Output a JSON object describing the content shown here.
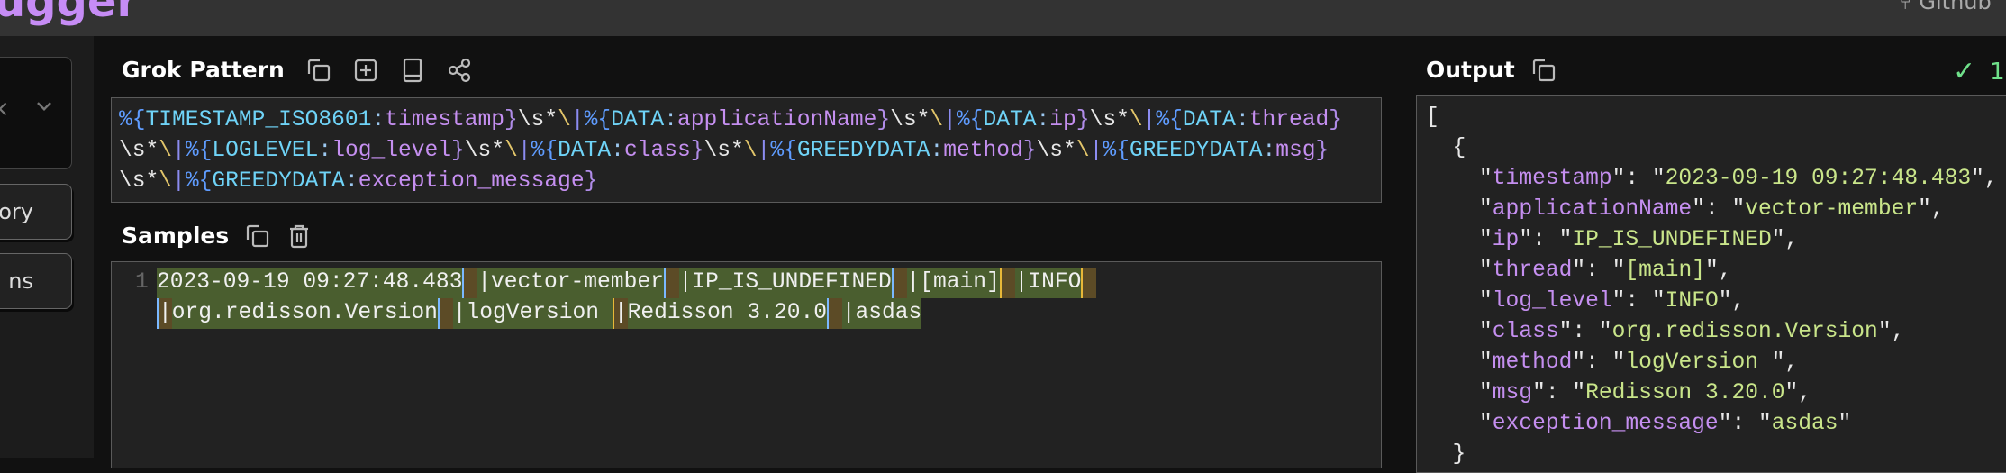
{
  "header": {
    "logo_text": "ugger",
    "github_label": "Github"
  },
  "sidebar": {
    "clear_glyph": "×",
    "buttons": [
      {
        "label": "tory"
      },
      {
        "label": "ns"
      }
    ]
  },
  "grok": {
    "title": "Grok Pattern",
    "icons": [
      "copy-icon",
      "add-icon",
      "book-icon",
      "share-icon"
    ],
    "lines": [
      [
        [
          "%{",
          "p-pct"
        ],
        [
          "TIMESTAMP_ISO8601",
          "p-name"
        ],
        [
          ":",
          "p-col"
        ],
        [
          "timestamp",
          "p-field"
        ],
        [
          "}",
          "p-cl"
        ],
        [
          "\\s*",
          "p-ws"
        ],
        [
          "\\",
          "p-bs"
        ],
        [
          "|",
          "p-bar"
        ],
        [
          "%{",
          "p-pct"
        ],
        [
          "DATA",
          "p-name"
        ],
        [
          ":",
          "p-col"
        ],
        [
          "applicationName",
          "p-field"
        ],
        [
          "}",
          "p-cl"
        ],
        [
          "\\s*",
          "p-ws"
        ],
        [
          "\\",
          "p-bs"
        ],
        [
          "|",
          "p-bar"
        ],
        [
          "%{",
          "p-pct"
        ],
        [
          "DATA",
          "p-name"
        ],
        [
          ":",
          "p-col"
        ],
        [
          "ip",
          "p-field"
        ],
        [
          "}",
          "p-cl"
        ],
        [
          "\\s*",
          "p-ws"
        ],
        [
          "\\",
          "p-bs"
        ],
        [
          "|",
          "p-bar"
        ],
        [
          "%{",
          "p-pct"
        ],
        [
          "DATA",
          "p-name"
        ],
        [
          ":",
          "p-col"
        ],
        [
          "thread",
          "p-field"
        ],
        [
          "}",
          "p-cl"
        ]
      ],
      [
        [
          "\\s*",
          "p-ws"
        ],
        [
          "\\",
          "p-bs"
        ],
        [
          "|",
          "p-bar"
        ],
        [
          "%{",
          "p-pct"
        ],
        [
          "LOGLEVEL",
          "p-name"
        ],
        [
          ":",
          "p-col"
        ],
        [
          "log_level",
          "p-field"
        ],
        [
          "}",
          "p-cl"
        ],
        [
          "\\s*",
          "p-ws"
        ],
        [
          "\\",
          "p-bs"
        ],
        [
          "|",
          "p-bar"
        ],
        [
          "%{",
          "p-pct"
        ],
        [
          "DATA",
          "p-name"
        ],
        [
          ":",
          "p-col"
        ],
        [
          "class",
          "p-field"
        ],
        [
          "}",
          "p-cl"
        ],
        [
          "\\s*",
          "p-ws"
        ],
        [
          "\\",
          "p-bs"
        ],
        [
          "|",
          "p-bar"
        ],
        [
          "%{",
          "p-pct"
        ],
        [
          "GREEDYDATA",
          "p-name"
        ],
        [
          ":",
          "p-col"
        ],
        [
          "method",
          "p-field"
        ],
        [
          "}",
          "p-cl"
        ],
        [
          "\\s*",
          "p-ws"
        ],
        [
          "\\",
          "p-bs"
        ],
        [
          "|",
          "p-bar"
        ],
        [
          "%{",
          "p-pct"
        ],
        [
          "GREEDYDATA",
          "p-name"
        ],
        [
          ":",
          "p-col"
        ],
        [
          "msg",
          "p-field"
        ],
        [
          "}",
          "p-cl"
        ]
      ],
      [
        [
          "\\s*",
          "p-ws"
        ],
        [
          "\\",
          "p-bs"
        ],
        [
          "|",
          "p-bar"
        ],
        [
          "%{",
          "p-pct"
        ],
        [
          "GREEDYDATA",
          "p-name"
        ],
        [
          ":",
          "p-col"
        ],
        [
          "exception_message",
          "p-field"
        ],
        [
          "}",
          "p-cl"
        ]
      ]
    ]
  },
  "samples": {
    "title": "Samples",
    "icons": [
      "copy-icon",
      "trash-icon"
    ],
    "line_number": "1",
    "lines": [
      [
        [
          "2023-09-19 09:27:48.483",
          "tok"
        ],
        [
          " ",
          "sep"
        ],
        [
          "|vector-member",
          "tok"
        ],
        [
          " ",
          "sep"
        ],
        [
          "|IP_IS_UNDEFINED",
          "tok"
        ],
        [
          " ",
          "sep"
        ],
        [
          "|[main]",
          "tok"
        ],
        [
          " ",
          "sep y"
        ],
        [
          "|INFO",
          "tok"
        ],
        [
          " ",
          "sep y"
        ]
      ],
      [
        [
          "|",
          "sep"
        ],
        [
          "org.redisson.Version",
          "tok"
        ],
        [
          " ",
          "sep"
        ],
        [
          "|logVersion ",
          "tok"
        ],
        [
          "|",
          "sep y"
        ],
        [
          "Redisson 3.20.0",
          "tok"
        ],
        [
          " ",
          "sep"
        ],
        [
          "|asdas",
          "tok"
        ]
      ]
    ]
  },
  "output": {
    "title": "Output",
    "status": "1,",
    "status_color": "#6fe08a",
    "fields": [
      {
        "key": "timestamp",
        "value": "2023-09-19 09:27:48.483"
      },
      {
        "key": "applicationName",
        "value": "vector-member"
      },
      {
        "key": "ip",
        "value": "IP_IS_UNDEFINED"
      },
      {
        "key": "thread",
        "value": "[main]"
      },
      {
        "key": "log_level",
        "value": "INFO"
      },
      {
        "key": "class",
        "value": "org.redisson.Version"
      },
      {
        "key": "method",
        "value": "logVersion "
      },
      {
        "key": "msg",
        "value": "Redisson 3.20.0"
      },
      {
        "key": "exception_message",
        "value": "asdas"
      }
    ]
  }
}
